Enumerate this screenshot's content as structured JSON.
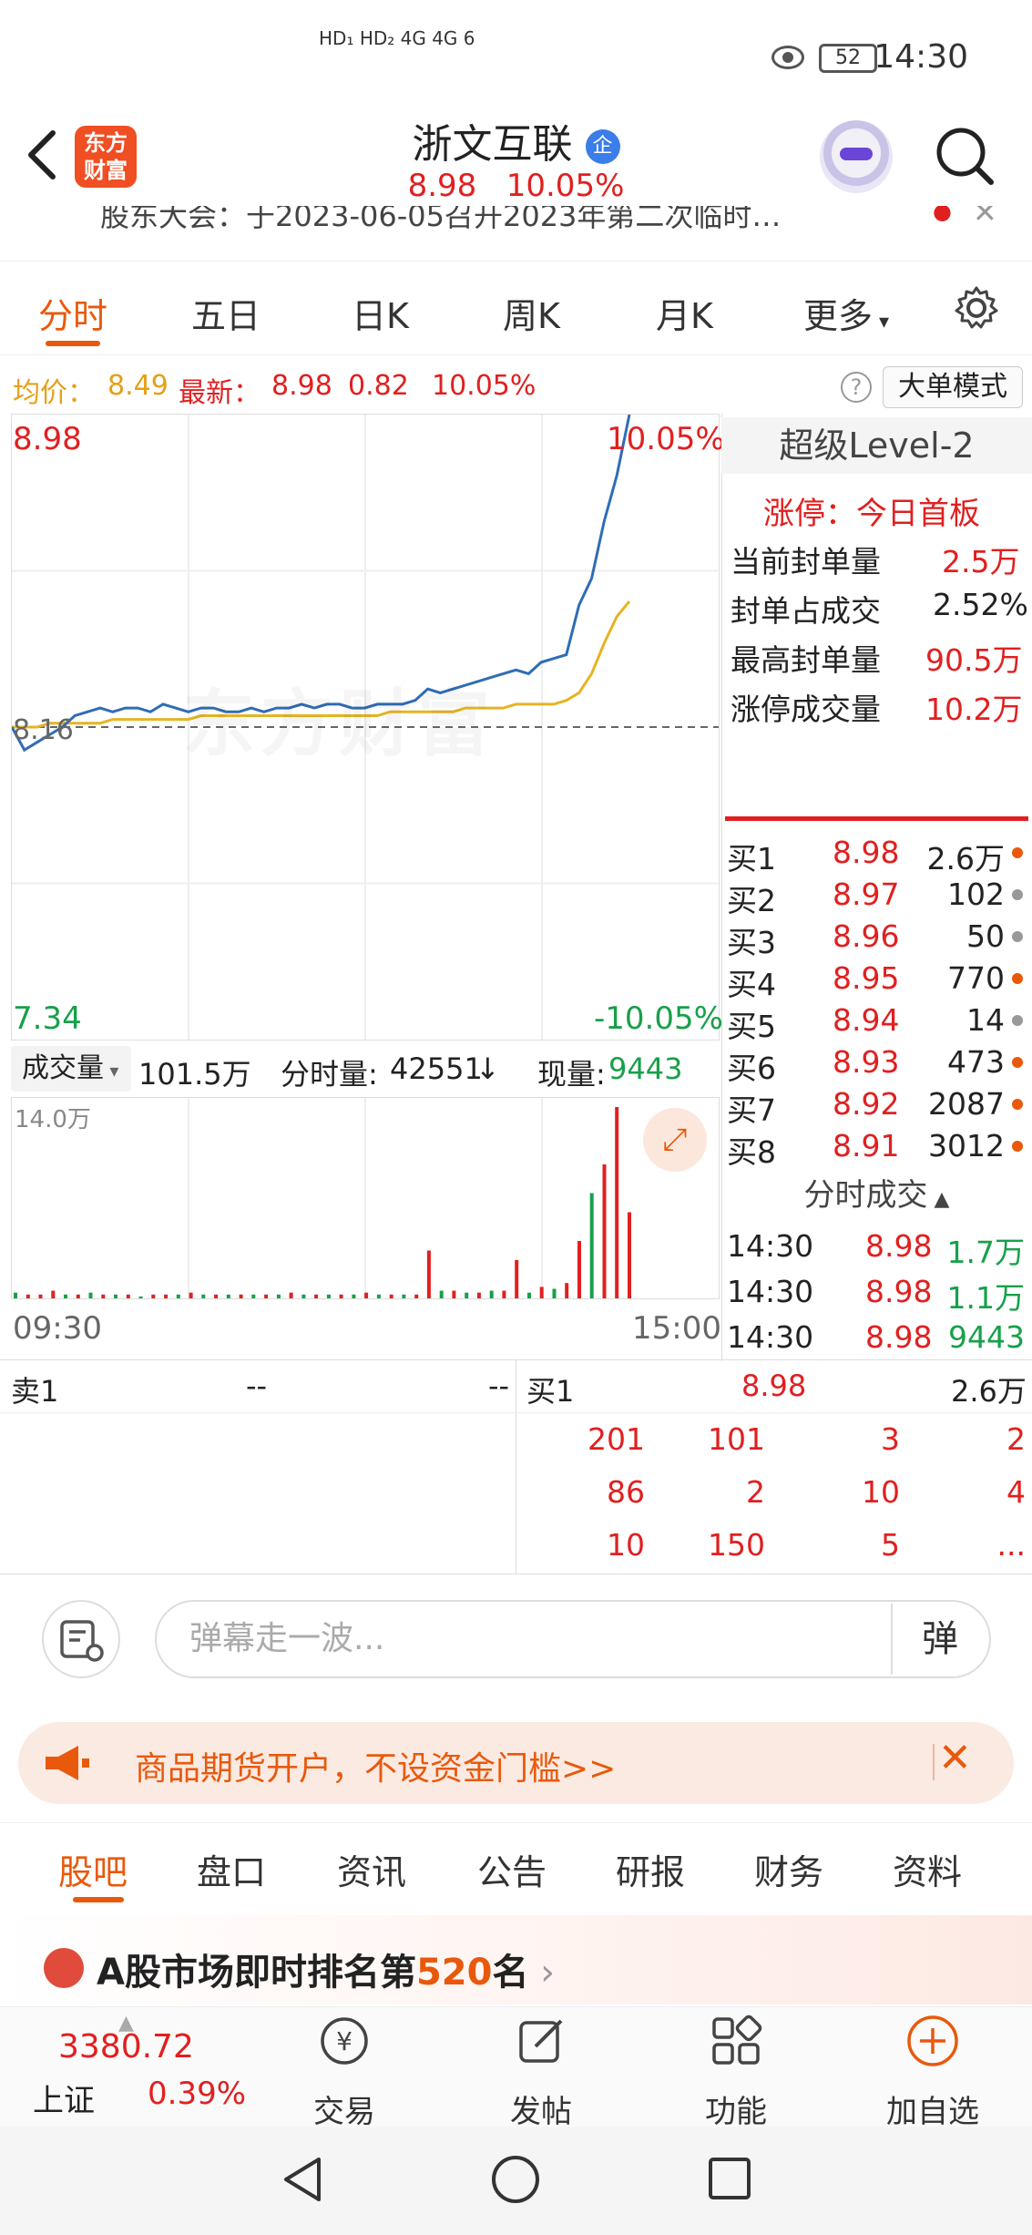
{
  "status_bar": {
    "signal": "HD₁ HD₂ 4G 4G 6",
    "battery": "52",
    "time": "14:30"
  },
  "header": {
    "logo_line1": "东方",
    "logo_line2": "财富",
    "stock_name": "浙文互联",
    "badge": "企",
    "price": "8.98",
    "change_pct": "10.05%",
    "ticker_text": "股东大会：于2023-06-05召开2023年第二次临时…"
  },
  "tabs": {
    "items": [
      "分时",
      "五日",
      "日K",
      "周K",
      "月K",
      "更多"
    ],
    "active": "分时"
  },
  "info_row": {
    "avg_label": "均价：",
    "avg_value": "8.49",
    "latest_label": "最新：",
    "latest_value": "8.98",
    "change": "0.82",
    "change_pct": "10.05%",
    "big_order_mode": "大单模式"
  },
  "chart_data": {
    "type": "line",
    "title": "",
    "x_start": "09:30",
    "x_end": "15:00",
    "ylim": [
      7.34,
      8.98
    ],
    "reference_price": 8.16,
    "top_left_label": "8.98",
    "top_right_label": "10.05%",
    "bottom_left_label": "7.34",
    "bottom_right_label": "-10.05%",
    "mid_label": "8.16",
    "series": [
      {
        "color": "#2f6db5",
        "values": [
          8.16,
          8.1,
          8.12,
          8.14,
          8.16,
          8.19,
          8.2,
          8.21,
          8.2,
          8.21,
          8.21,
          8.2,
          8.22,
          8.21,
          8.2,
          8.21,
          8.21,
          8.2,
          8.2,
          8.21,
          8.2,
          8.21,
          8.21,
          8.22,
          8.21,
          8.22,
          8.22,
          8.21,
          8.21,
          8.22,
          8.22,
          8.22,
          8.23,
          8.26,
          8.25,
          8.26,
          8.27,
          8.28,
          8.29,
          8.3,
          8.31,
          8.3,
          8.33,
          8.34,
          8.35,
          8.48,
          8.55,
          8.7,
          8.82,
          8.98
        ]
      },
      {
        "color": "#e6b422",
        "values": [
          8.16,
          8.16,
          8.16,
          8.17,
          8.17,
          8.17,
          8.17,
          8.17,
          8.18,
          8.18,
          8.18,
          8.18,
          8.18,
          8.18,
          8.18,
          8.19,
          8.19,
          8.19,
          8.19,
          8.19,
          8.19,
          8.19,
          8.19,
          8.19,
          8.19,
          8.19,
          8.19,
          8.19,
          8.19,
          8.19,
          8.2,
          8.2,
          8.2,
          8.2,
          8.2,
          8.2,
          8.21,
          8.21,
          8.21,
          8.21,
          8.22,
          8.22,
          8.22,
          8.22,
          8.23,
          8.25,
          8.3,
          8.38,
          8.45,
          8.49
        ]
      }
    ],
    "volume": {
      "max_label": "14.0万",
      "values": [
        3,
        2,
        2,
        4,
        2,
        2,
        3,
        2,
        2,
        2,
        1,
        2,
        2,
        2,
        3,
        2,
        2,
        2,
        2,
        2,
        2,
        2,
        3,
        2,
        2,
        2,
        2,
        2,
        3,
        2,
        2,
        2,
        2,
        25,
        4,
        4,
        3,
        3,
        4,
        4,
        20,
        3,
        6,
        5,
        8,
        30,
        55,
        70,
        100,
        45
      ],
      "colors": [
        "green",
        "red",
        "red",
        "red",
        "green",
        "red",
        "green",
        "red",
        "green",
        "red",
        "green",
        "red",
        "red",
        "green",
        "red",
        "green",
        "red",
        "green",
        "red",
        "green",
        "red",
        "green",
        "red",
        "green",
        "red",
        "green",
        "red",
        "green",
        "red",
        "green",
        "red",
        "green",
        "red",
        "red",
        "green",
        "red",
        "green",
        "red",
        "green",
        "red",
        "red",
        "green",
        "red",
        "green",
        "red",
        "red",
        "green",
        "red",
        "red",
        "red"
      ]
    }
  },
  "volume_row": {
    "select_label": "成交量",
    "total": "101.5万",
    "fenshi_label": "分时量:",
    "fenshi_value": "42551",
    "arrow": "↓",
    "current_label": "现量:",
    "current_value": "9443"
  },
  "level2": {
    "title": "超级Level-2",
    "limit_status": "涨停：今日首板",
    "rows": [
      {
        "label": "当前封单量",
        "value": "2.5万"
      },
      {
        "label": "封单占成交",
        "value": "2.52%"
      },
      {
        "label": "最高封单量",
        "value": "90.5万"
      },
      {
        "label": "涨停成交量",
        "value": "10.2万"
      }
    ]
  },
  "bids": [
    {
      "label": "买1",
      "price": "8.98",
      "vol": "2.6万",
      "dot": "#e8590c"
    },
    {
      "label": "买2",
      "price": "8.97",
      "vol": "102",
      "dot": "#999999"
    },
    {
      "label": "买3",
      "price": "8.96",
      "vol": "50",
      "dot": "#999999"
    },
    {
      "label": "买4",
      "price": "8.95",
      "vol": "770",
      "dot": "#e8590c"
    },
    {
      "label": "买5",
      "price": "8.94",
      "vol": "14",
      "dot": "#999999"
    },
    {
      "label": "买6",
      "price": "8.93",
      "vol": "473",
      "dot": "#e8590c"
    },
    {
      "label": "买7",
      "price": "8.92",
      "vol": "2087",
      "dot": "#e8590c"
    },
    {
      "label": "买8",
      "price": "8.91",
      "vol": "3012",
      "dot": "#e8590c"
    }
  ],
  "fenshi_trades": {
    "title": "分时成交",
    "rows": [
      {
        "time": "14:30",
        "price": "8.98",
        "vol": "1.7万"
      },
      {
        "time": "14:30",
        "price": "8.98",
        "vol": "1.1万"
      },
      {
        "time": "14:30",
        "price": "8.98",
        "vol": "9443"
      }
    ]
  },
  "queue": {
    "sell_label": "卖1",
    "sell_price": "--",
    "sell_vol": "--",
    "buy_label": "买1",
    "buy_price": "8.98",
    "buy_vol": "2.6万",
    "orders": [
      [
        "201",
        "101",
        "3",
        "2"
      ],
      [
        "86",
        "2",
        "10",
        "4"
      ],
      [
        "10",
        "150",
        "5",
        "..."
      ]
    ]
  },
  "danmu": {
    "placeholder": "弹幕走一波...",
    "button": "弹"
  },
  "banner": {
    "text": "商品期货开户，不设资金门槛>>"
  },
  "bottom_tabs": {
    "items": [
      "股吧",
      "盘口",
      "资讯",
      "公告",
      "研报",
      "财务",
      "资料"
    ],
    "active": "股吧"
  },
  "rank": {
    "prefix": "A股市场即时排名第",
    "rank": "520",
    "suffix": "名"
  },
  "bottom_nav": {
    "index_value": "3380.72",
    "index_name": "上证",
    "index_change": "0.39%",
    "items": [
      {
        "label": "交易",
        "icon": "trade-icon"
      },
      {
        "label": "发帖",
        "icon": "post-icon"
      },
      {
        "label": "功能",
        "icon": "function-icon"
      },
      {
        "label": "加自选",
        "icon": "add-watchlist-icon"
      }
    ]
  }
}
